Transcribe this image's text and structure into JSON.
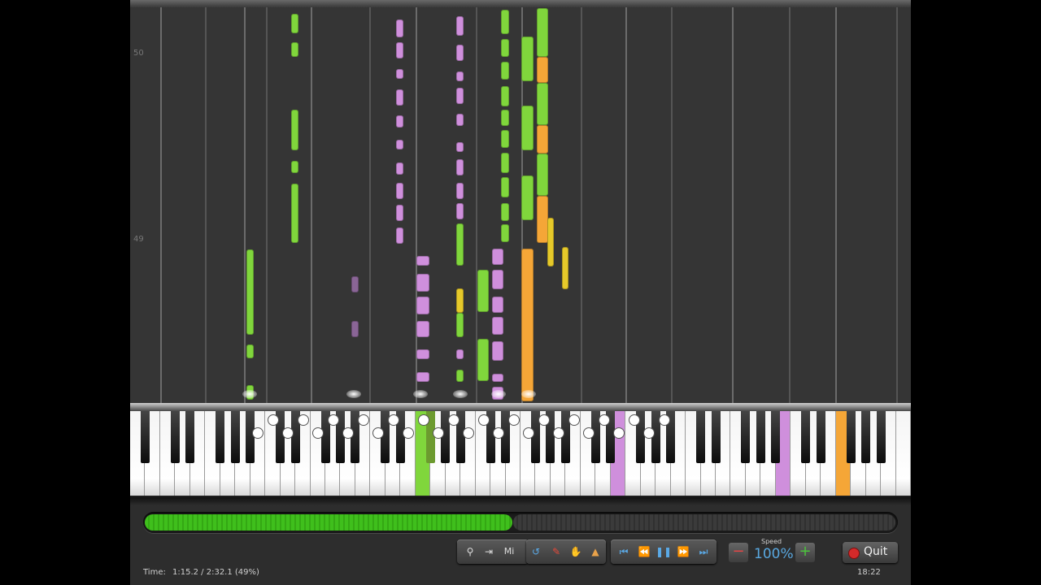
{
  "roll": {
    "measure_top": "50",
    "measure_bottom": "49"
  },
  "playback": {
    "progress_percent": 49,
    "time_label": "Time:",
    "time_value": "1:15.2 / 2:32.1 (49%)"
  },
  "toolbar": {
    "mic_label": "Mi"
  },
  "speed": {
    "label": "Speed",
    "value": "100%"
  },
  "quit": {
    "label": "Quit"
  },
  "clock": "18:22",
  "colors": {
    "green": "#80d63c",
    "purple": "#cf8fdc",
    "orange": "#f5a637",
    "yellow": "#e6c92a",
    "progress": "#3fbf1c",
    "speed": "#59a8e0"
  },
  "icons": {
    "zoom": "magnifier-icon",
    "output": "output-icon",
    "undo": "undo-icon",
    "pencil": "pencil-icon",
    "hand": "hand-icon",
    "metronome": "metronome-icon",
    "skip_back": "skip-back-icon",
    "rewind": "rewind-icon",
    "pause": "pause-icon",
    "forward": "fast-forward-icon",
    "skip_forward": "skip-forward-icon",
    "quit": "stop-icon"
  }
}
